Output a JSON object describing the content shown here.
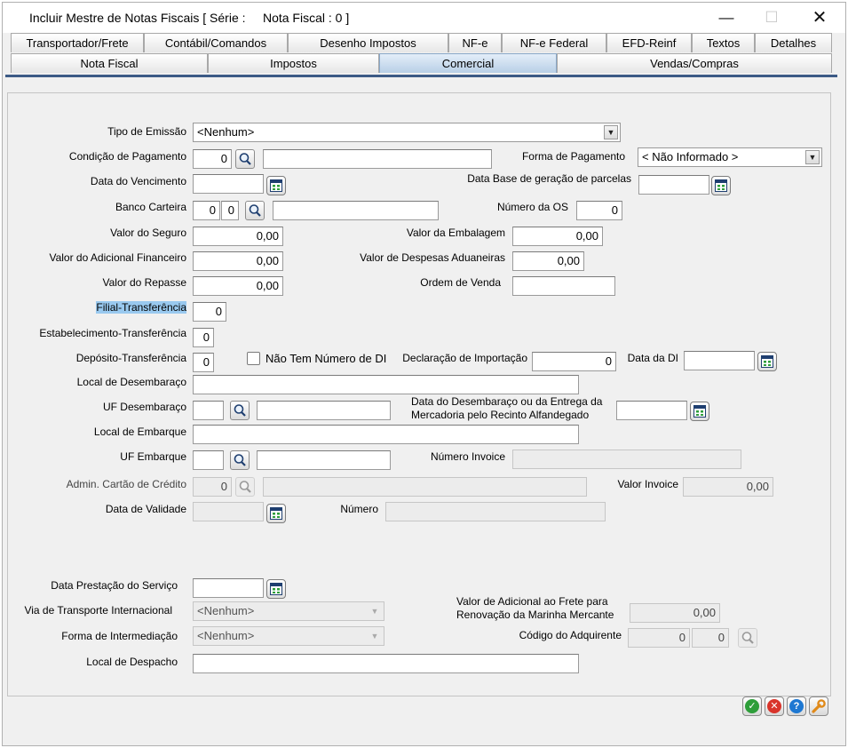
{
  "window": {
    "title": "Incluir Mestre de Notas Fiscais [ Série :     Nota Fiscal : 0 ]",
    "minimize": "—",
    "maximize": "☐",
    "close": "✕"
  },
  "tabs_row1": [
    "Transportador/Frete",
    "Contábil/Comandos",
    "Desenho Impostos",
    "NF-e",
    "NF-e Federal",
    "EFD-Reinf",
    "Textos",
    "Detalhes"
  ],
  "tabs_row2": [
    "Nota Fiscal",
    "Impostos",
    "Comercial",
    "Vendas/Compras"
  ],
  "active_tab": "Comercial",
  "form": {
    "tipo_emissao": {
      "label": "Tipo de Emissão",
      "value": "<Nenhum>"
    },
    "condicao_pagamento": {
      "label": "Condição de Pagamento",
      "code": "0",
      "desc": ""
    },
    "forma_pagamento": {
      "label": "Forma de Pagamento",
      "value": "< Não Informado >"
    },
    "data_vencimento": {
      "label": "Data do Vencimento",
      "value": ""
    },
    "data_base_parcelas": {
      "label": "Data Base de geração de parcelas",
      "value": ""
    },
    "banco_carteira": {
      "label": "Banco Carteira",
      "banco": "0",
      "carteira": "0",
      "desc": ""
    },
    "numero_os": {
      "label": "Número da OS",
      "value": "0"
    },
    "valor_seguro": {
      "label": "Valor do Seguro",
      "value": "0,00"
    },
    "valor_embalagem": {
      "label": "Valor da Embalagem",
      "value": "0,00"
    },
    "valor_adicional_financeiro": {
      "label": "Valor do Adicional Financeiro",
      "value": "0,00"
    },
    "valor_despesas_aduaneiras": {
      "label": "Valor de Despesas Aduaneiras",
      "value": "0,00"
    },
    "valor_repasse": {
      "label": "Valor do Repasse",
      "value": "0,00"
    },
    "ordem_venda": {
      "label": "Ordem de Venda",
      "value": ""
    },
    "filial_transferencia": {
      "label": "Filial-Transferência",
      "value": "0"
    },
    "estabelecimento_transferencia": {
      "label": "Estabelecimento-Transferência",
      "value": "0"
    },
    "deposito_transferencia": {
      "label": "Depósito-Transferência",
      "value": "0"
    },
    "nao_tem_numero_di": {
      "label": "Não Tem Número de DI",
      "checked": false
    },
    "declaracao_importacao": {
      "label": "Declaração de Importação",
      "value": "0"
    },
    "data_di": {
      "label": "Data da DI",
      "value": ""
    },
    "local_desembaraco": {
      "label": "Local de Desembaraço",
      "value": ""
    },
    "uf_desembaraco": {
      "label": "UF Desembaraço",
      "code": "",
      "desc": ""
    },
    "data_desembaraco": {
      "label_line1": "Data do Desembaraço ou da Entrega da",
      "label_line2": "Mercadoria pelo Recinto Alfandegado",
      "value": ""
    },
    "local_embarque": {
      "label": "Local de Embarque",
      "value": ""
    },
    "uf_embarque": {
      "label": "UF Embarque",
      "code": "",
      "desc": ""
    },
    "numero_invoice": {
      "label": "Número Invoice",
      "value": ""
    },
    "admin_cartao": {
      "label": "Admin. Cartão de Crédito",
      "code": "0",
      "desc": ""
    },
    "valor_invoice": {
      "label": "Valor Invoice",
      "value": "0,00"
    },
    "data_validade": {
      "label": "Data de Validade",
      "value": ""
    },
    "numero": {
      "label": "Número",
      "value": ""
    },
    "data_prestacao_servico": {
      "label": "Data Prestação do Serviço",
      "value": ""
    },
    "via_transporte": {
      "label": "Via de Transporte Internacional",
      "value": "<Nenhum>"
    },
    "valor_adicional_frete": {
      "label_line1": "Valor de Adicional ao Frete para",
      "label_line2": "Renovação da Marinha Mercante",
      "value": "0,00"
    },
    "forma_intermediacao": {
      "label": "Forma de Intermediação",
      "value": "<Nenhum>"
    },
    "codigo_adquirente": {
      "label": "Código do Adquirente",
      "code1": "0",
      "code2": "0"
    },
    "local_despacho": {
      "label": "Local de Despacho",
      "value": ""
    }
  },
  "colors": {
    "accent": "#3c5a85",
    "highlight": "#99c9ef",
    "ok": "#2e9e3a",
    "cancel": "#d9342b",
    "help": "#1e78d2",
    "tools": "#e08a1a"
  },
  "icons": [
    "search-icon",
    "calendar-icon",
    "check-icon",
    "cancel-icon",
    "help-icon",
    "wrench-icon",
    "dropdown-arrow-icon"
  ]
}
